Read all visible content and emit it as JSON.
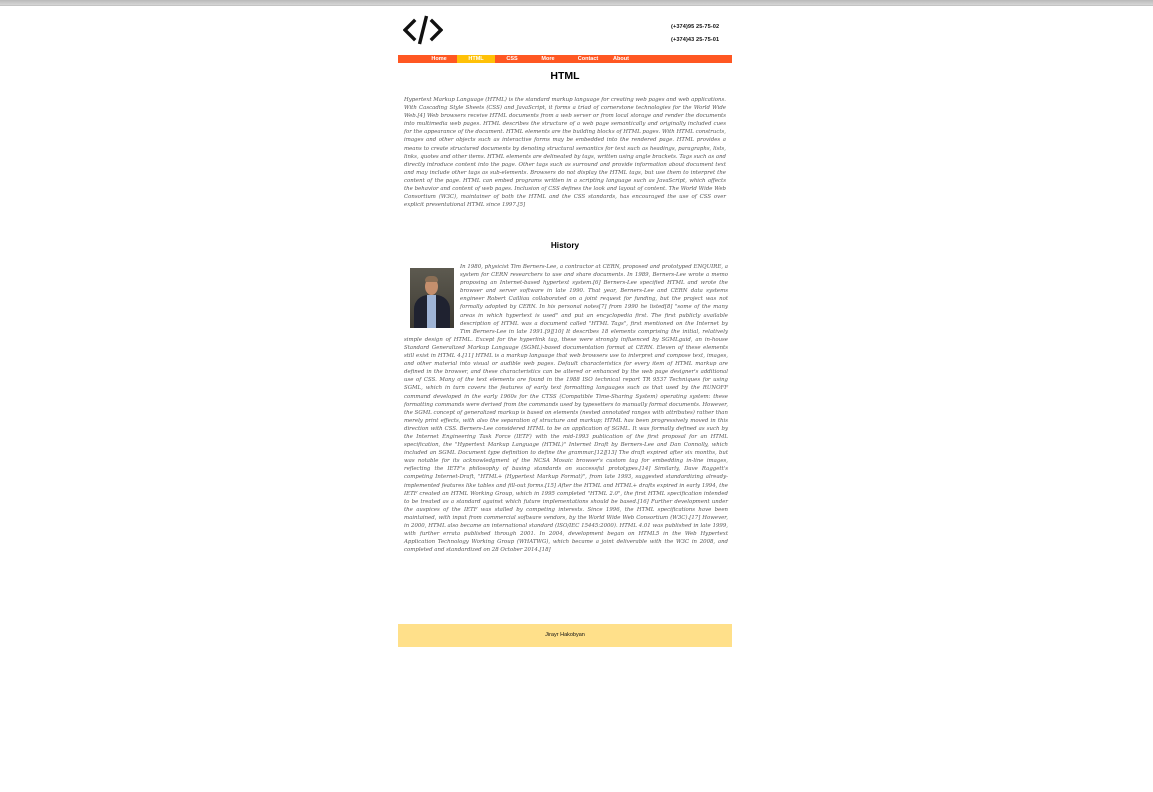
{
  "header": {
    "logo": "code-icon",
    "phones": [
      "(+374)95 25-75-02",
      "(+374)43 25-75-01"
    ]
  },
  "nav": {
    "items": [
      "Home",
      "HTML",
      "CSS",
      "More",
      "Contact",
      "About"
    ],
    "active": "HTML",
    "colors": {
      "bar": "#ff5722",
      "active": "#ffc107"
    }
  },
  "main": {
    "title": "HTML",
    "intro": "Hypertext Markup Language (HTML) is the standard markup language for creating web pages and web applications. With Cascading Style Sheets (CSS) and JavaScript, it forms a triad of cornerstone technologies for the World Wide Web.[4] Web browsers receive HTML documents from a web server or from local storage and render the documents into multimedia web pages. HTML describes the structure of a web page semantically and originally included cues for the appearance of the document. HTML elements are the building blocks of HTML pages. With HTML constructs, images and other objects such as interactive forms may be embedded into the rendered page. HTML provides a means to create structured documents by denoting structural semantics for text such as headings, paragraphs, lists, links, quotes and other items. HTML elements are delineated by tags, written using angle brackets. Tags such as and directly introduce content into the page. Other tags such as surround and provide information about document text and may include other tags as sub-elements. Browsers do not display the HTML tags, but use them to interpret the content of the page. HTML can embed programs written in a scripting language such as JavaScript, which affects the behavior and content of web pages. Inclusion of CSS defines the look and layout of content. The World Wide Web Consortium (W3C), maintainer of both the HTML and the CSS standards, has encouraged the use of CSS over explicit presentational HTML since 1997.[5]",
    "history_title": "History",
    "history": "In 1980, physicist Tim Berners-Lee, a contractor at CERN, proposed and prototyped ENQUIRE, a system for CERN researchers to use and share documents. In 1989, Berners-Lee wrote a memo proposing an Internet-based hypertext system.[6] Berners-Lee specified HTML and wrote the browser and server software in late 1990. That year, Berners-Lee and CERN data systems engineer Robert Cailliau collaborated on a joint request for funding, but the project was not formally adopted by CERN. In his personal notes[7] from 1990 he listed[8] \"some of the many areas in which hypertext is used\" and put an encyclopedia first. The first publicly available description of HTML was a document called \"HTML Tags\", first mentioned on the Internet by Tim Berners-Lee in late 1991.[9][10] It describes 18 elements comprising the initial, relatively simple design of HTML. Except for the hyperlink tag, these were strongly influenced by SGMLguid, an in-house Standard Generalized Markup Language (SGML)-based documentation format at CERN. Eleven of these elements still exist in HTML 4.[11] HTML is a markup language that web browsers use to interpret and compose text, images, and other material into visual or audible web pages. Default characteristics for every item of HTML markup are defined in the browser, and these characteristics can be altered or enhanced by the web page designer's additional use of CSS. Many of the text elements are found in the 1988 ISO technical report TR 9537 Techniques for using SGML, which in turn covers the features of early text formatting languages such as that used by the RUNOFF command developed in the early 1960s for the CTSS (Compatible Time-Sharing System) operating system: these formatting commands were derived from the commands used by typesetters to manually format documents. However, the SGML concept of generalized markup is based on elements (nested annotated ranges with attributes) rather than merely print effects, with also the separation of structure and markup; HTML has been progressively moved in this direction with CSS. Berners-Lee considered HTML to be an application of SGML. It was formally defined as such by the Internet Engineering Task Force (IETF) with the mid-1993 publication of the first proposal for an HTML specification, the \"Hypertext Markup Language (HTML)\" Internet Draft by Berners-Lee and Dan Connolly, which included an SGML Document type definition to define the grammar.[12][13] The draft expired after six months, but was notable for its acknowledgment of the NCSA Mosaic browser's custom tag for embedding in-line images, reflecting the IETF's philosophy of basing standards on successful prototypes.[14] Similarly, Dave Raggett's competing Internet-Draft, \"HTML+ (Hypertext Markup Format)\", from late 1993, suggested standardizing already-implemented features like tables and fill-out forms.[15] After the HTML and HTML+ drafts expired in early 1994, the IETF created an HTML Working Group, which in 1995 completed \"HTML 2.0\", the first HTML specification intended to be treated as a standard against which future implementations should be based.[16] Further development under the auspices of the IETF was stalled by competing interests. Since 1996, the HTML specifications have been maintained, with input from commercial software vendors, by the World Wide Web Consortium (W3C).[17] However, in 2000, HTML also became an international standard (ISO/IEC 15445:2000). HTML 4.01 was published in late 1999, with further errata published through 2001. In 2004, development began on HTML5 in the Web Hypertext Application Technology Working Group (WHATWG), which became a joint deliverable with the W3C in 2008, and completed and standardized on 28 October 2014.[18]",
    "photo": "portrait-photo"
  },
  "footer": {
    "text": "Jirayr Hakobyan",
    "color": "#ffe08a"
  }
}
